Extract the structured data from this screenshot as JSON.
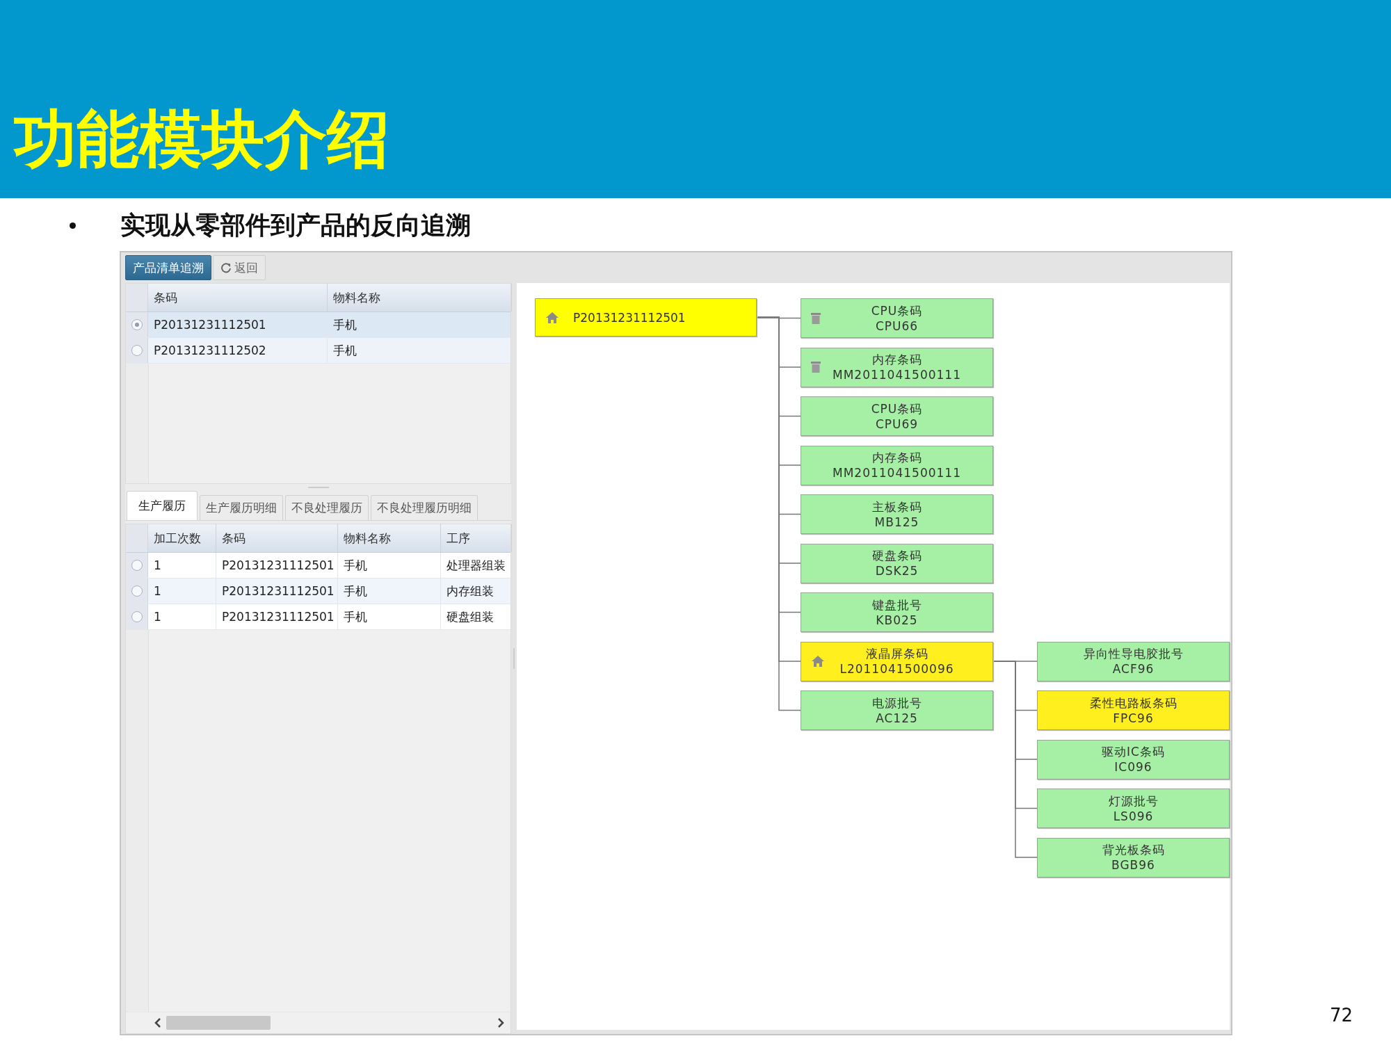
{
  "slide": {
    "title": "功能模块介绍",
    "bullet": "实现从零部件到产品的反向追溯",
    "page_number": "72"
  },
  "toolbar": [
    {
      "label": "产品清单追溯",
      "selected": true
    },
    {
      "label": "返回",
      "selected": false,
      "kind": "refresh"
    }
  ],
  "product_list": {
    "columns": [
      "条码",
      "物料名称"
    ],
    "rows": [
      {
        "cells": [
          "P20131231112501",
          "手机"
        ],
        "selected": true
      },
      {
        "cells": [
          "P20131231112502",
          "手机"
        ],
        "selected": false
      }
    ]
  },
  "detail_tabs": [
    {
      "label": "生产履历",
      "selected": true
    },
    {
      "label": "生产履历明细",
      "selected": false
    },
    {
      "label": "不良处理履历",
      "selected": false
    },
    {
      "label": "不良处理履历明细",
      "selected": false
    }
  ],
  "history": {
    "columns": [
      "加工次数",
      "条码",
      "物料名称",
      "工序"
    ],
    "rows": [
      {
        "cells": [
          "1",
          "P20131231112501",
          "手机",
          "处理器组装"
        ],
        "selected": false
      },
      {
        "cells": [
          "1",
          "P20131231112501",
          "手机",
          "内存组装"
        ],
        "selected": false
      },
      {
        "cells": [
          "1",
          "P20131231112501",
          "手机",
          "硬盘组装"
        ],
        "selected": false
      }
    ]
  },
  "trace_tree": {
    "code": "P20131231112501",
    "color": "#ffff00",
    "kind": "home",
    "children": [
      {
        "label": "CPU条码",
        "code": "CPU66",
        "color": "#a6f0a6",
        "kind": "bin"
      },
      {
        "label": "内存条码",
        "code": "MM2011041500111",
        "color": "#a6f0a6",
        "kind": "bin"
      },
      {
        "label": "CPU条码",
        "code": "CPU69",
        "color": "#a6f0a6"
      },
      {
        "label": "内存条码",
        "code": "MM2011041500111",
        "color": "#a6f0a6"
      },
      {
        "label": "主板条码",
        "code": "MB125",
        "color": "#a6f0a6"
      },
      {
        "label": "硬盘条码",
        "code": "DSK25",
        "color": "#a6f0a6"
      },
      {
        "label": "键盘批号",
        "code": "KB025",
        "color": "#a6f0a6"
      },
      {
        "label": "液晶屏条码",
        "code": "L2011041500096",
        "color": "#ffef1f",
        "kind": "home",
        "children": [
          {
            "label": "异向性导电胶批号",
            "code": "ACF96",
            "color": "#a6f0a6"
          },
          {
            "label": "柔性电路板条码",
            "code": "FPC96",
            "color": "#ffef1f"
          },
          {
            "label": "驱动IC条码",
            "code": "IC096",
            "color": "#a6f0a6"
          },
          {
            "label": "灯源批号",
            "code": "LS096",
            "color": "#a6f0a6"
          },
          {
            "label": "背光板条码",
            "code": "BGB96",
            "color": "#a6f0a6"
          }
        ]
      },
      {
        "label": "电源批号",
        "code": "AC125",
        "color": "#a6f0a6"
      }
    ]
  }
}
